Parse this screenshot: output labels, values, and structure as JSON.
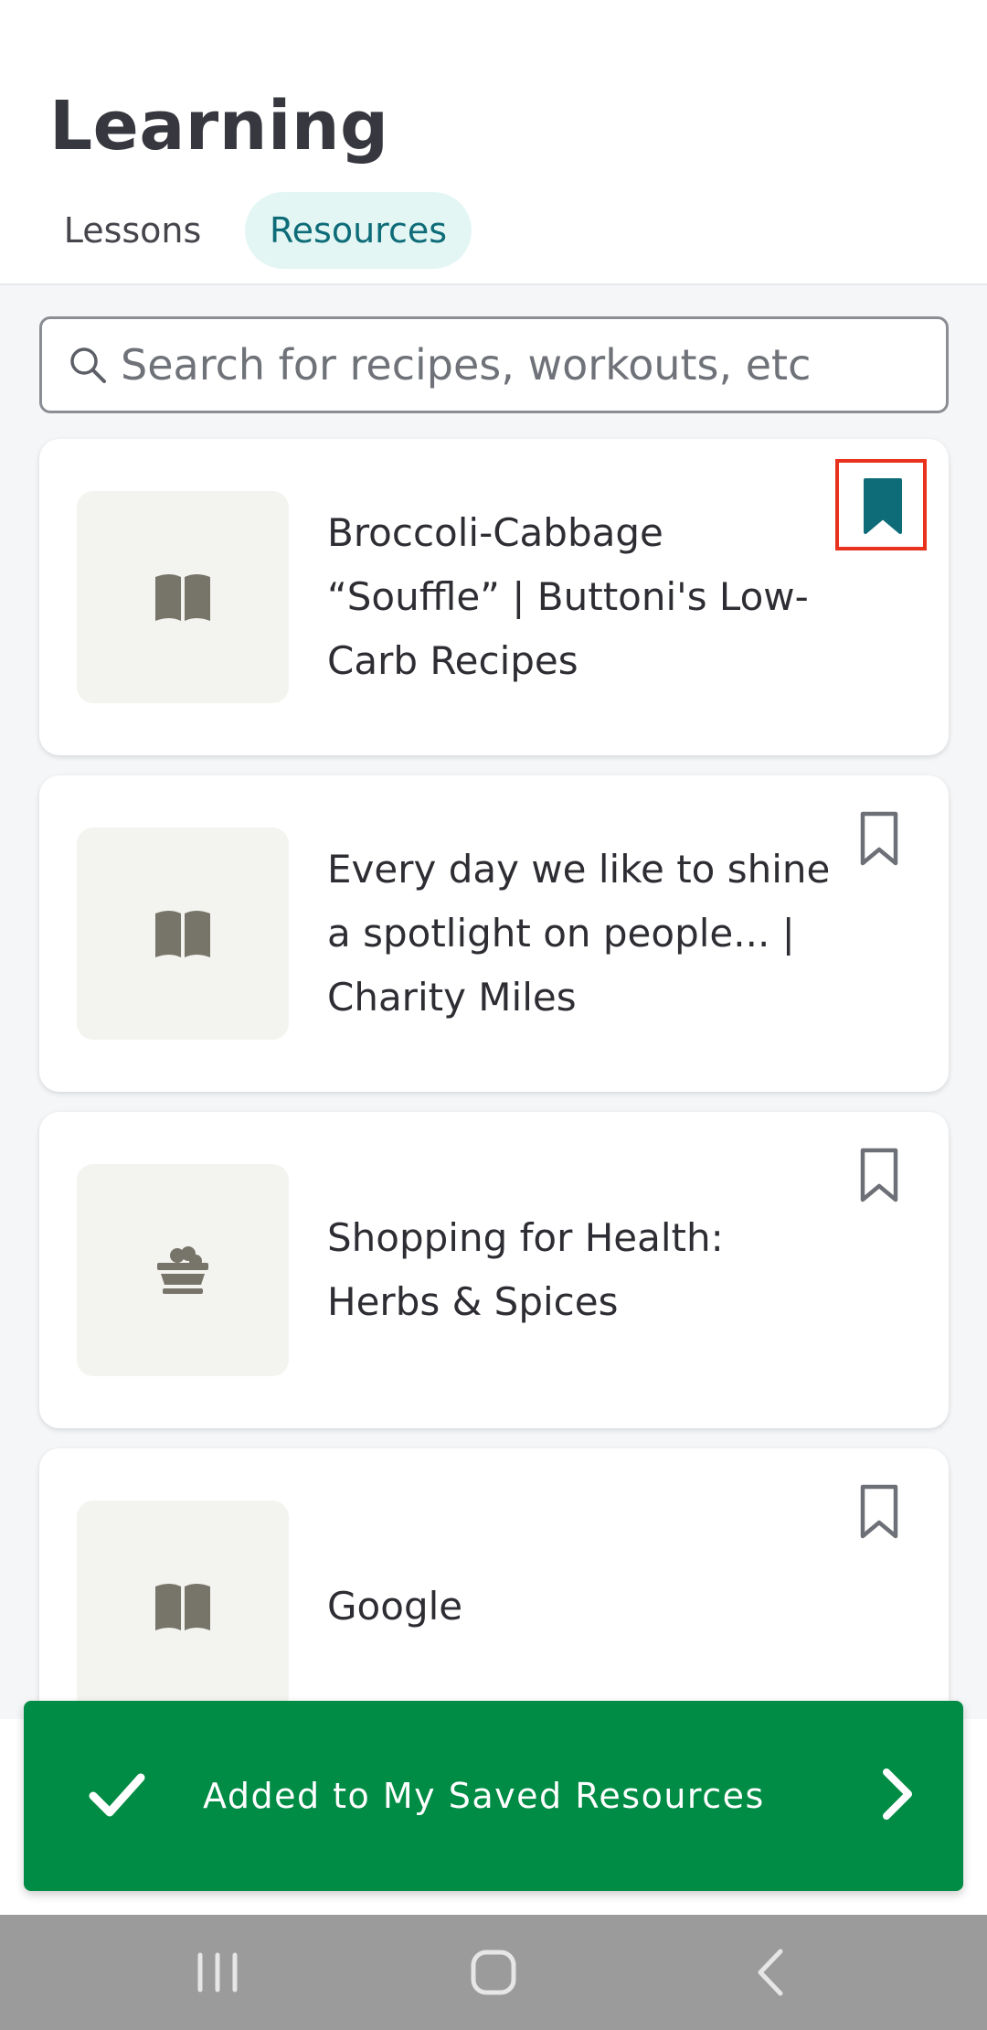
{
  "header": {
    "title": "Learning",
    "tabs": [
      {
        "label": "Lessons",
        "selected": false
      },
      {
        "label": "Resources",
        "selected": true
      }
    ]
  },
  "search": {
    "placeholder": "Search for recipes, workouts, etc",
    "value": ""
  },
  "resources": [
    {
      "title": "Broccoli-Cabbage “Souffle” | Buttoni's Low-Carb Recipes",
      "icon": "book-icon",
      "bookmarked": true
    },
    {
      "title": "Every day we like to shine a spotlight on people... | Charity Miles",
      "icon": "book-icon",
      "bookmarked": false
    },
    {
      "title": "Shopping for Health: Herbs & Spices",
      "icon": "food-basket-icon",
      "bookmarked": false
    },
    {
      "title": "Google",
      "icon": "book-icon",
      "bookmarked": false
    }
  ],
  "toast": {
    "message": "Added to My Saved Resources",
    "icon": "checkmark-icon",
    "action_icon": "chevron-right-icon"
  },
  "colors": {
    "accent_teal": "#0E6C78",
    "tab_selected_bg": "#E3F6F4",
    "toast_green": "#008C44",
    "highlight_red": "#E8321E",
    "thumb_icon": "#77756A"
  },
  "system_nav": {
    "buttons": [
      "recent-apps-icon",
      "home-icon",
      "back-icon"
    ]
  }
}
